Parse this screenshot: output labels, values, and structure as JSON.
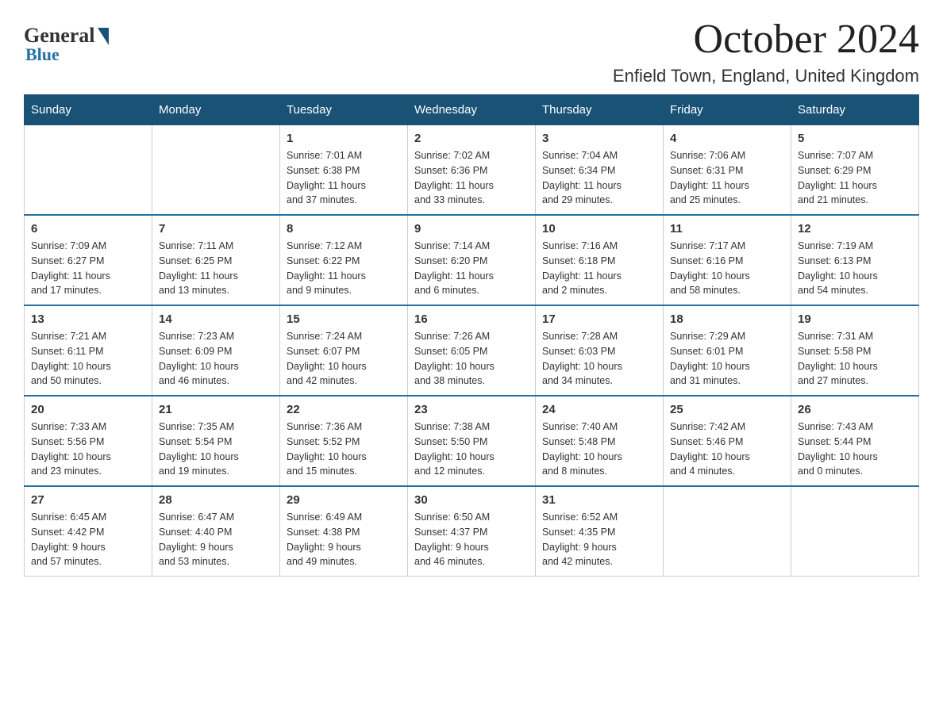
{
  "header": {
    "logo_general": "General",
    "logo_blue": "Blue",
    "month": "October 2024",
    "location": "Enfield Town, England, United Kingdom"
  },
  "days_of_week": [
    "Sunday",
    "Monday",
    "Tuesday",
    "Wednesday",
    "Thursday",
    "Friday",
    "Saturday"
  ],
  "weeks": [
    [
      {
        "day": "",
        "info": ""
      },
      {
        "day": "",
        "info": ""
      },
      {
        "day": "1",
        "info": "Sunrise: 7:01 AM\nSunset: 6:38 PM\nDaylight: 11 hours\nand 37 minutes."
      },
      {
        "day": "2",
        "info": "Sunrise: 7:02 AM\nSunset: 6:36 PM\nDaylight: 11 hours\nand 33 minutes."
      },
      {
        "day": "3",
        "info": "Sunrise: 7:04 AM\nSunset: 6:34 PM\nDaylight: 11 hours\nand 29 minutes."
      },
      {
        "day": "4",
        "info": "Sunrise: 7:06 AM\nSunset: 6:31 PM\nDaylight: 11 hours\nand 25 minutes."
      },
      {
        "day": "5",
        "info": "Sunrise: 7:07 AM\nSunset: 6:29 PM\nDaylight: 11 hours\nand 21 minutes."
      }
    ],
    [
      {
        "day": "6",
        "info": "Sunrise: 7:09 AM\nSunset: 6:27 PM\nDaylight: 11 hours\nand 17 minutes."
      },
      {
        "day": "7",
        "info": "Sunrise: 7:11 AM\nSunset: 6:25 PM\nDaylight: 11 hours\nand 13 minutes."
      },
      {
        "day": "8",
        "info": "Sunrise: 7:12 AM\nSunset: 6:22 PM\nDaylight: 11 hours\nand 9 minutes."
      },
      {
        "day": "9",
        "info": "Sunrise: 7:14 AM\nSunset: 6:20 PM\nDaylight: 11 hours\nand 6 minutes."
      },
      {
        "day": "10",
        "info": "Sunrise: 7:16 AM\nSunset: 6:18 PM\nDaylight: 11 hours\nand 2 minutes."
      },
      {
        "day": "11",
        "info": "Sunrise: 7:17 AM\nSunset: 6:16 PM\nDaylight: 10 hours\nand 58 minutes."
      },
      {
        "day": "12",
        "info": "Sunrise: 7:19 AM\nSunset: 6:13 PM\nDaylight: 10 hours\nand 54 minutes."
      }
    ],
    [
      {
        "day": "13",
        "info": "Sunrise: 7:21 AM\nSunset: 6:11 PM\nDaylight: 10 hours\nand 50 minutes."
      },
      {
        "day": "14",
        "info": "Sunrise: 7:23 AM\nSunset: 6:09 PM\nDaylight: 10 hours\nand 46 minutes."
      },
      {
        "day": "15",
        "info": "Sunrise: 7:24 AM\nSunset: 6:07 PM\nDaylight: 10 hours\nand 42 minutes."
      },
      {
        "day": "16",
        "info": "Sunrise: 7:26 AM\nSunset: 6:05 PM\nDaylight: 10 hours\nand 38 minutes."
      },
      {
        "day": "17",
        "info": "Sunrise: 7:28 AM\nSunset: 6:03 PM\nDaylight: 10 hours\nand 34 minutes."
      },
      {
        "day": "18",
        "info": "Sunrise: 7:29 AM\nSunset: 6:01 PM\nDaylight: 10 hours\nand 31 minutes."
      },
      {
        "day": "19",
        "info": "Sunrise: 7:31 AM\nSunset: 5:58 PM\nDaylight: 10 hours\nand 27 minutes."
      }
    ],
    [
      {
        "day": "20",
        "info": "Sunrise: 7:33 AM\nSunset: 5:56 PM\nDaylight: 10 hours\nand 23 minutes."
      },
      {
        "day": "21",
        "info": "Sunrise: 7:35 AM\nSunset: 5:54 PM\nDaylight: 10 hours\nand 19 minutes."
      },
      {
        "day": "22",
        "info": "Sunrise: 7:36 AM\nSunset: 5:52 PM\nDaylight: 10 hours\nand 15 minutes."
      },
      {
        "day": "23",
        "info": "Sunrise: 7:38 AM\nSunset: 5:50 PM\nDaylight: 10 hours\nand 12 minutes."
      },
      {
        "day": "24",
        "info": "Sunrise: 7:40 AM\nSunset: 5:48 PM\nDaylight: 10 hours\nand 8 minutes."
      },
      {
        "day": "25",
        "info": "Sunrise: 7:42 AM\nSunset: 5:46 PM\nDaylight: 10 hours\nand 4 minutes."
      },
      {
        "day": "26",
        "info": "Sunrise: 7:43 AM\nSunset: 5:44 PM\nDaylight: 10 hours\nand 0 minutes."
      }
    ],
    [
      {
        "day": "27",
        "info": "Sunrise: 6:45 AM\nSunset: 4:42 PM\nDaylight: 9 hours\nand 57 minutes."
      },
      {
        "day": "28",
        "info": "Sunrise: 6:47 AM\nSunset: 4:40 PM\nDaylight: 9 hours\nand 53 minutes."
      },
      {
        "day": "29",
        "info": "Sunrise: 6:49 AM\nSunset: 4:38 PM\nDaylight: 9 hours\nand 49 minutes."
      },
      {
        "day": "30",
        "info": "Sunrise: 6:50 AM\nSunset: 4:37 PM\nDaylight: 9 hours\nand 46 minutes."
      },
      {
        "day": "31",
        "info": "Sunrise: 6:52 AM\nSunset: 4:35 PM\nDaylight: 9 hours\nand 42 minutes."
      },
      {
        "day": "",
        "info": ""
      },
      {
        "day": "",
        "info": ""
      }
    ]
  ]
}
